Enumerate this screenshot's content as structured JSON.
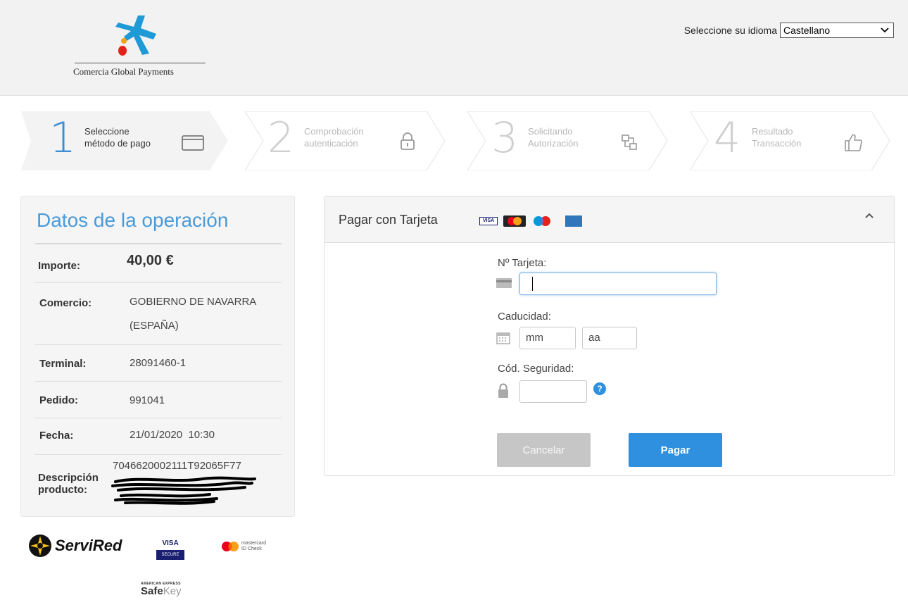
{
  "header": {
    "logo_text": "Comercia Global Payments",
    "language_label": "Seleccione su idioma",
    "language_selected": "Castellano"
  },
  "steps": [
    {
      "number": "1",
      "label_line1": "Seleccione",
      "label_line2": "método de pago",
      "icon": "credit-card-icon",
      "state": "active"
    },
    {
      "number": "2",
      "label_line1": "Comprobación",
      "label_line2": "autenticación",
      "icon": "lock-icon",
      "state": "inactive"
    },
    {
      "number": "3",
      "label_line1": "Solicitando",
      "label_line2": "Autorización",
      "icon": "network-icon",
      "state": "inactive"
    },
    {
      "number": "4",
      "label_line1": "Resultado",
      "label_line2": "Transacción",
      "icon": "thumbs-up-icon",
      "state": "inactive"
    }
  ],
  "operation": {
    "title": "Datos de la operación",
    "rows": [
      {
        "label": "Importe:",
        "value": "40,00 €"
      },
      {
        "label": "Comercio:",
        "value_line1": "GOBIERNO DE NAVARRA",
        "value_line2": "(ESPAÑA)"
      },
      {
        "label": "Terminal:",
        "value": "28091460-1"
      },
      {
        "label": "Pedido:",
        "value": "991041"
      },
      {
        "label": "Fecha:",
        "value": "21/01/2020  10:30"
      },
      {
        "label_line1": "Descripción",
        "label_line2": "producto:",
        "value": "7046620002111T92065F77"
      }
    ]
  },
  "security_logos": {
    "servired": "ServiRed",
    "visa_top": "VISA",
    "visa_bottom": "SECURE",
    "mastercard_line1": "mastercard",
    "mastercard_line2": "ID Check",
    "amex_top": "AMERICAN EXPRESS",
    "amex_safe": "Safe",
    "amex_key": "Key"
  },
  "card_form": {
    "title": "Pagar con Tarjeta",
    "brand_visa": "VISA",
    "card_number_label": "Nº Tarjeta:",
    "card_number_value": "",
    "expiry_label": "Caducidad:",
    "month_value": "mm",
    "year_value": "aa",
    "cvv_label": "Cód. Seguridad:",
    "cvv_value": "",
    "help_symbol": "?",
    "cancel_label": "Cancelar",
    "pay_label": "Pagar"
  },
  "colors": {
    "accent_blue": "#2e90df",
    "title_blue": "#4a9ad8",
    "logo_blue": "#1e9ad6",
    "logo_orange": "#f3a21b",
    "logo_red": "#e2231a"
  }
}
